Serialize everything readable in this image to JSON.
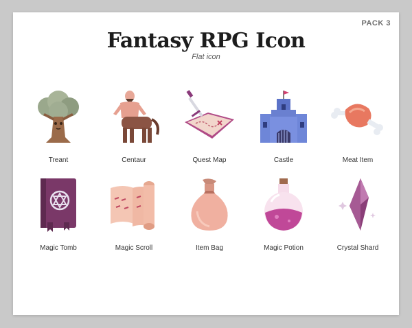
{
  "pack_label": "PACK 3",
  "title": "Fantasy RPG Icon",
  "subtitle": "Flat icon",
  "icons": [
    {
      "label": "Treant"
    },
    {
      "label": "Centaur"
    },
    {
      "label": "Quest Map"
    },
    {
      "label": "Castle"
    },
    {
      "label": "Meat Item"
    },
    {
      "label": "Magic Tomb"
    },
    {
      "label": "Magic Scroll"
    },
    {
      "label": "Item Bag"
    },
    {
      "label": "Magic Potion"
    },
    {
      "label": "Crystal Shard"
    }
  ]
}
